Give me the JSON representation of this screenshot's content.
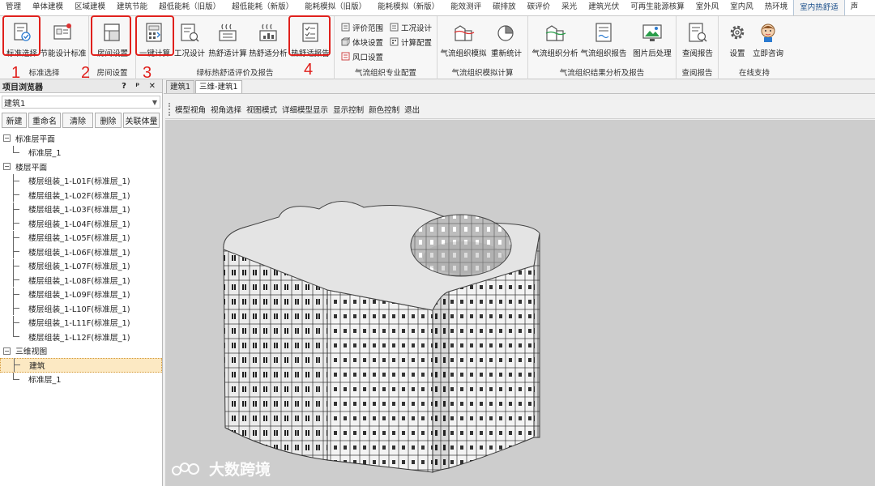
{
  "menu_tabs": [
    "管理",
    "单体建模",
    "区域建模",
    "建筑节能",
    "超低能耗（旧版）",
    "超低能耗（新版）",
    "能耗模拟（旧版）",
    "能耗模拟（新版）",
    "能效测评",
    "碳排放",
    "碳评价",
    "采光",
    "建筑光伏",
    "可再生能源核算",
    "室外风",
    "室内风",
    "热环境",
    "室内热舒适",
    "声"
  ],
  "active_tab": "室内热舒适",
  "ribbon": {
    "groups": [
      {
        "label": "标准选择",
        "buttons": [
          "标准选择",
          "节能设计标准"
        ]
      },
      {
        "label": "房间设置",
        "buttons": [
          "房间设置"
        ]
      },
      {
        "label": "绿标热舒适评价及报告",
        "buttons": [
          "一键计算",
          "工况设计",
          "热舒适计算",
          "热舒适分析",
          "热舒适报告"
        ]
      },
      {
        "label": "气流组织专业配置",
        "small_buttons": [
          "评价范围",
          "体块设置",
          "风口设置",
          "工况设计",
          "计算配置"
        ]
      },
      {
        "label": "气流组织模拟计算",
        "buttons": [
          "气流组织模拟",
          "重新统计"
        ]
      },
      {
        "label": "气流组织结果分析及报告",
        "buttons": [
          "气流组织分析",
          "气流组织报告",
          "图片后处理"
        ]
      },
      {
        "label": "查阅报告",
        "buttons": [
          "查阅报告"
        ]
      },
      {
        "label": "在线支持",
        "buttons": [
          "设置",
          "立即咨询"
        ]
      }
    ]
  },
  "annotations": [
    "1",
    "2",
    "3",
    "4"
  ],
  "left_panel": {
    "title": "项目浏览器",
    "title_controls": "? ᵖ ✕",
    "building_select": "建筑1",
    "buttons": [
      "新建",
      "重命名",
      "清除",
      "删除",
      "关联体量"
    ],
    "tree": [
      {
        "label": "标准层平面",
        "level": 0,
        "expander": "−"
      },
      {
        "label": "标准层_1",
        "level": 1,
        "last": true
      },
      {
        "label": "楼层平面",
        "level": 0,
        "expander": "−"
      },
      {
        "label": "楼层组装_1-L01F(标准层_1)",
        "level": 1
      },
      {
        "label": "楼层组装_1-L02F(标准层_1)",
        "level": 1
      },
      {
        "label": "楼层组装_1-L03F(标准层_1)",
        "level": 1
      },
      {
        "label": "楼层组装_1-L04F(标准层_1)",
        "level": 1
      },
      {
        "label": "楼层组装_1-L05F(标准层_1)",
        "level": 1
      },
      {
        "label": "楼层组装_1-L06F(标准层_1)",
        "level": 1
      },
      {
        "label": "楼层组装_1-L07F(标准层_1)",
        "level": 1
      },
      {
        "label": "楼层组装_1-L08F(标准层_1)",
        "level": 1
      },
      {
        "label": "楼层组装_1-L09F(标准层_1)",
        "level": 1
      },
      {
        "label": "楼层组装_1-L10F(标准层_1)",
        "level": 1
      },
      {
        "label": "楼层组装_1-L11F(标准层_1)",
        "level": 1
      },
      {
        "label": "楼层组装_1-L12F(标准层_1)",
        "level": 1,
        "last": true
      },
      {
        "label": "三维视图",
        "level": 0,
        "expander": "−"
      },
      {
        "label": "建筑",
        "level": 1,
        "selected": true
      },
      {
        "label": "标准层_1",
        "level": 1,
        "last": true
      }
    ]
  },
  "doc_tabs": [
    "建筑1",
    "三维-建筑1"
  ],
  "active_doc_tab": "三维-建筑1",
  "toolbar_items": [
    "模型视角",
    "视角选择",
    "视图模式",
    "详细模型显示",
    "显示控制",
    "颜色控制",
    "退出"
  ],
  "watermark": "大数跨境",
  "colors": {
    "annotation": "#e0201c",
    "viewport_bg": "#cdcdcd",
    "accent": "#1a4e8a"
  }
}
